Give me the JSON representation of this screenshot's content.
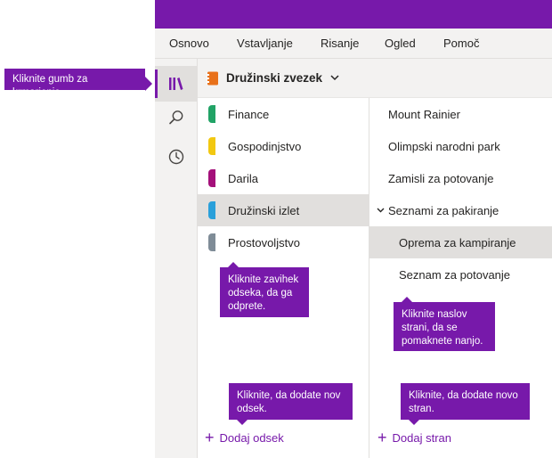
{
  "ribbon": {
    "tabs": [
      "Osnovo",
      "Vstavljanje",
      "Risanje",
      "Ogled",
      "Pomoč"
    ]
  },
  "navigation": {
    "icons": [
      "notebooks-icon",
      "search-icon",
      "recent-icon"
    ]
  },
  "notebook": {
    "title": "Družinski zvezek"
  },
  "sections": [
    {
      "label": "Finance",
      "color": "#21a366"
    },
    {
      "label": "Gospodinjstvo",
      "color": "#f2c811"
    },
    {
      "label": "Darila",
      "color": "#a4107a"
    },
    {
      "label": "Družinski izlet",
      "color": "#2aa0da"
    },
    {
      "label": "Prostovoljstvo",
      "color": "#7f8c97"
    }
  ],
  "pages": [
    {
      "label": "Mount Rainier"
    },
    {
      "label": "Olimpski narodni park"
    },
    {
      "label": "Zamisli za potovanje"
    },
    {
      "label": "Seznami za pakiranje"
    },
    {
      "label": "Oprema za kampiranje"
    },
    {
      "label": "Seznam za potovanje"
    }
  ],
  "add_section_label": "Dodaj odsek",
  "add_page_label": "Dodaj stran",
  "callouts": {
    "nav_button": "Kliknite gumb za krmarjenje",
    "section_tab": [
      "Kliknite zavihek",
      "odseka, da ga",
      "odprete."
    ],
    "page_title": [
      "Kliknite naslov",
      "strani, da se",
      "pomaknete nanjo."
    ],
    "add_section": [
      "Kliknite, da dodate nov",
      "odsek."
    ],
    "add_page": [
      "Kliknite, da dodate novo",
      "stran."
    ]
  },
  "colors": {
    "accent": "#7719aa",
    "chrome": "#f3f2f1",
    "selected": "#e1dfdd",
    "notebook_icon": "#e8711a"
  }
}
